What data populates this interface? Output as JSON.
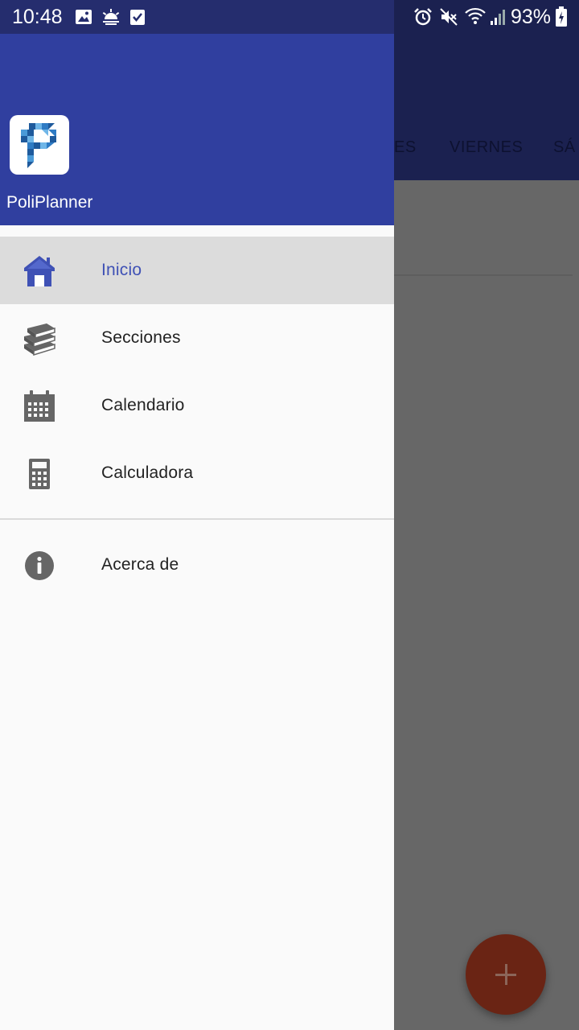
{
  "status_bar": {
    "time": "10:48",
    "battery": "93%",
    "left_icons": [
      "image-icon",
      "weather-icon",
      "checkbox-icon"
    ],
    "right_icons": [
      "alarm-icon",
      "mute-icon",
      "wifi-icon",
      "signal-icon",
      "battery-charging-icon"
    ]
  },
  "background_app": {
    "tabs": [
      "ES",
      "VIERNES",
      "SÁ"
    ],
    "fab_label": "+",
    "colors": {
      "appbar": "#1b2150",
      "fab": "#6a2414"
    }
  },
  "drawer": {
    "app_name": "PoliPlanner",
    "header_color": "#303f9f",
    "accent": "#3f51b5",
    "items": [
      {
        "label": "Inicio",
        "icon": "home-icon",
        "active": true
      },
      {
        "label": "Secciones",
        "icon": "books-icon",
        "active": false
      },
      {
        "label": "Calendario",
        "icon": "calendar-icon",
        "active": false
      },
      {
        "label": "Calculadora",
        "icon": "calculator-icon",
        "active": false
      }
    ],
    "secondary_items": [
      {
        "label": "Acerca de",
        "icon": "info-icon",
        "active": false
      }
    ]
  }
}
